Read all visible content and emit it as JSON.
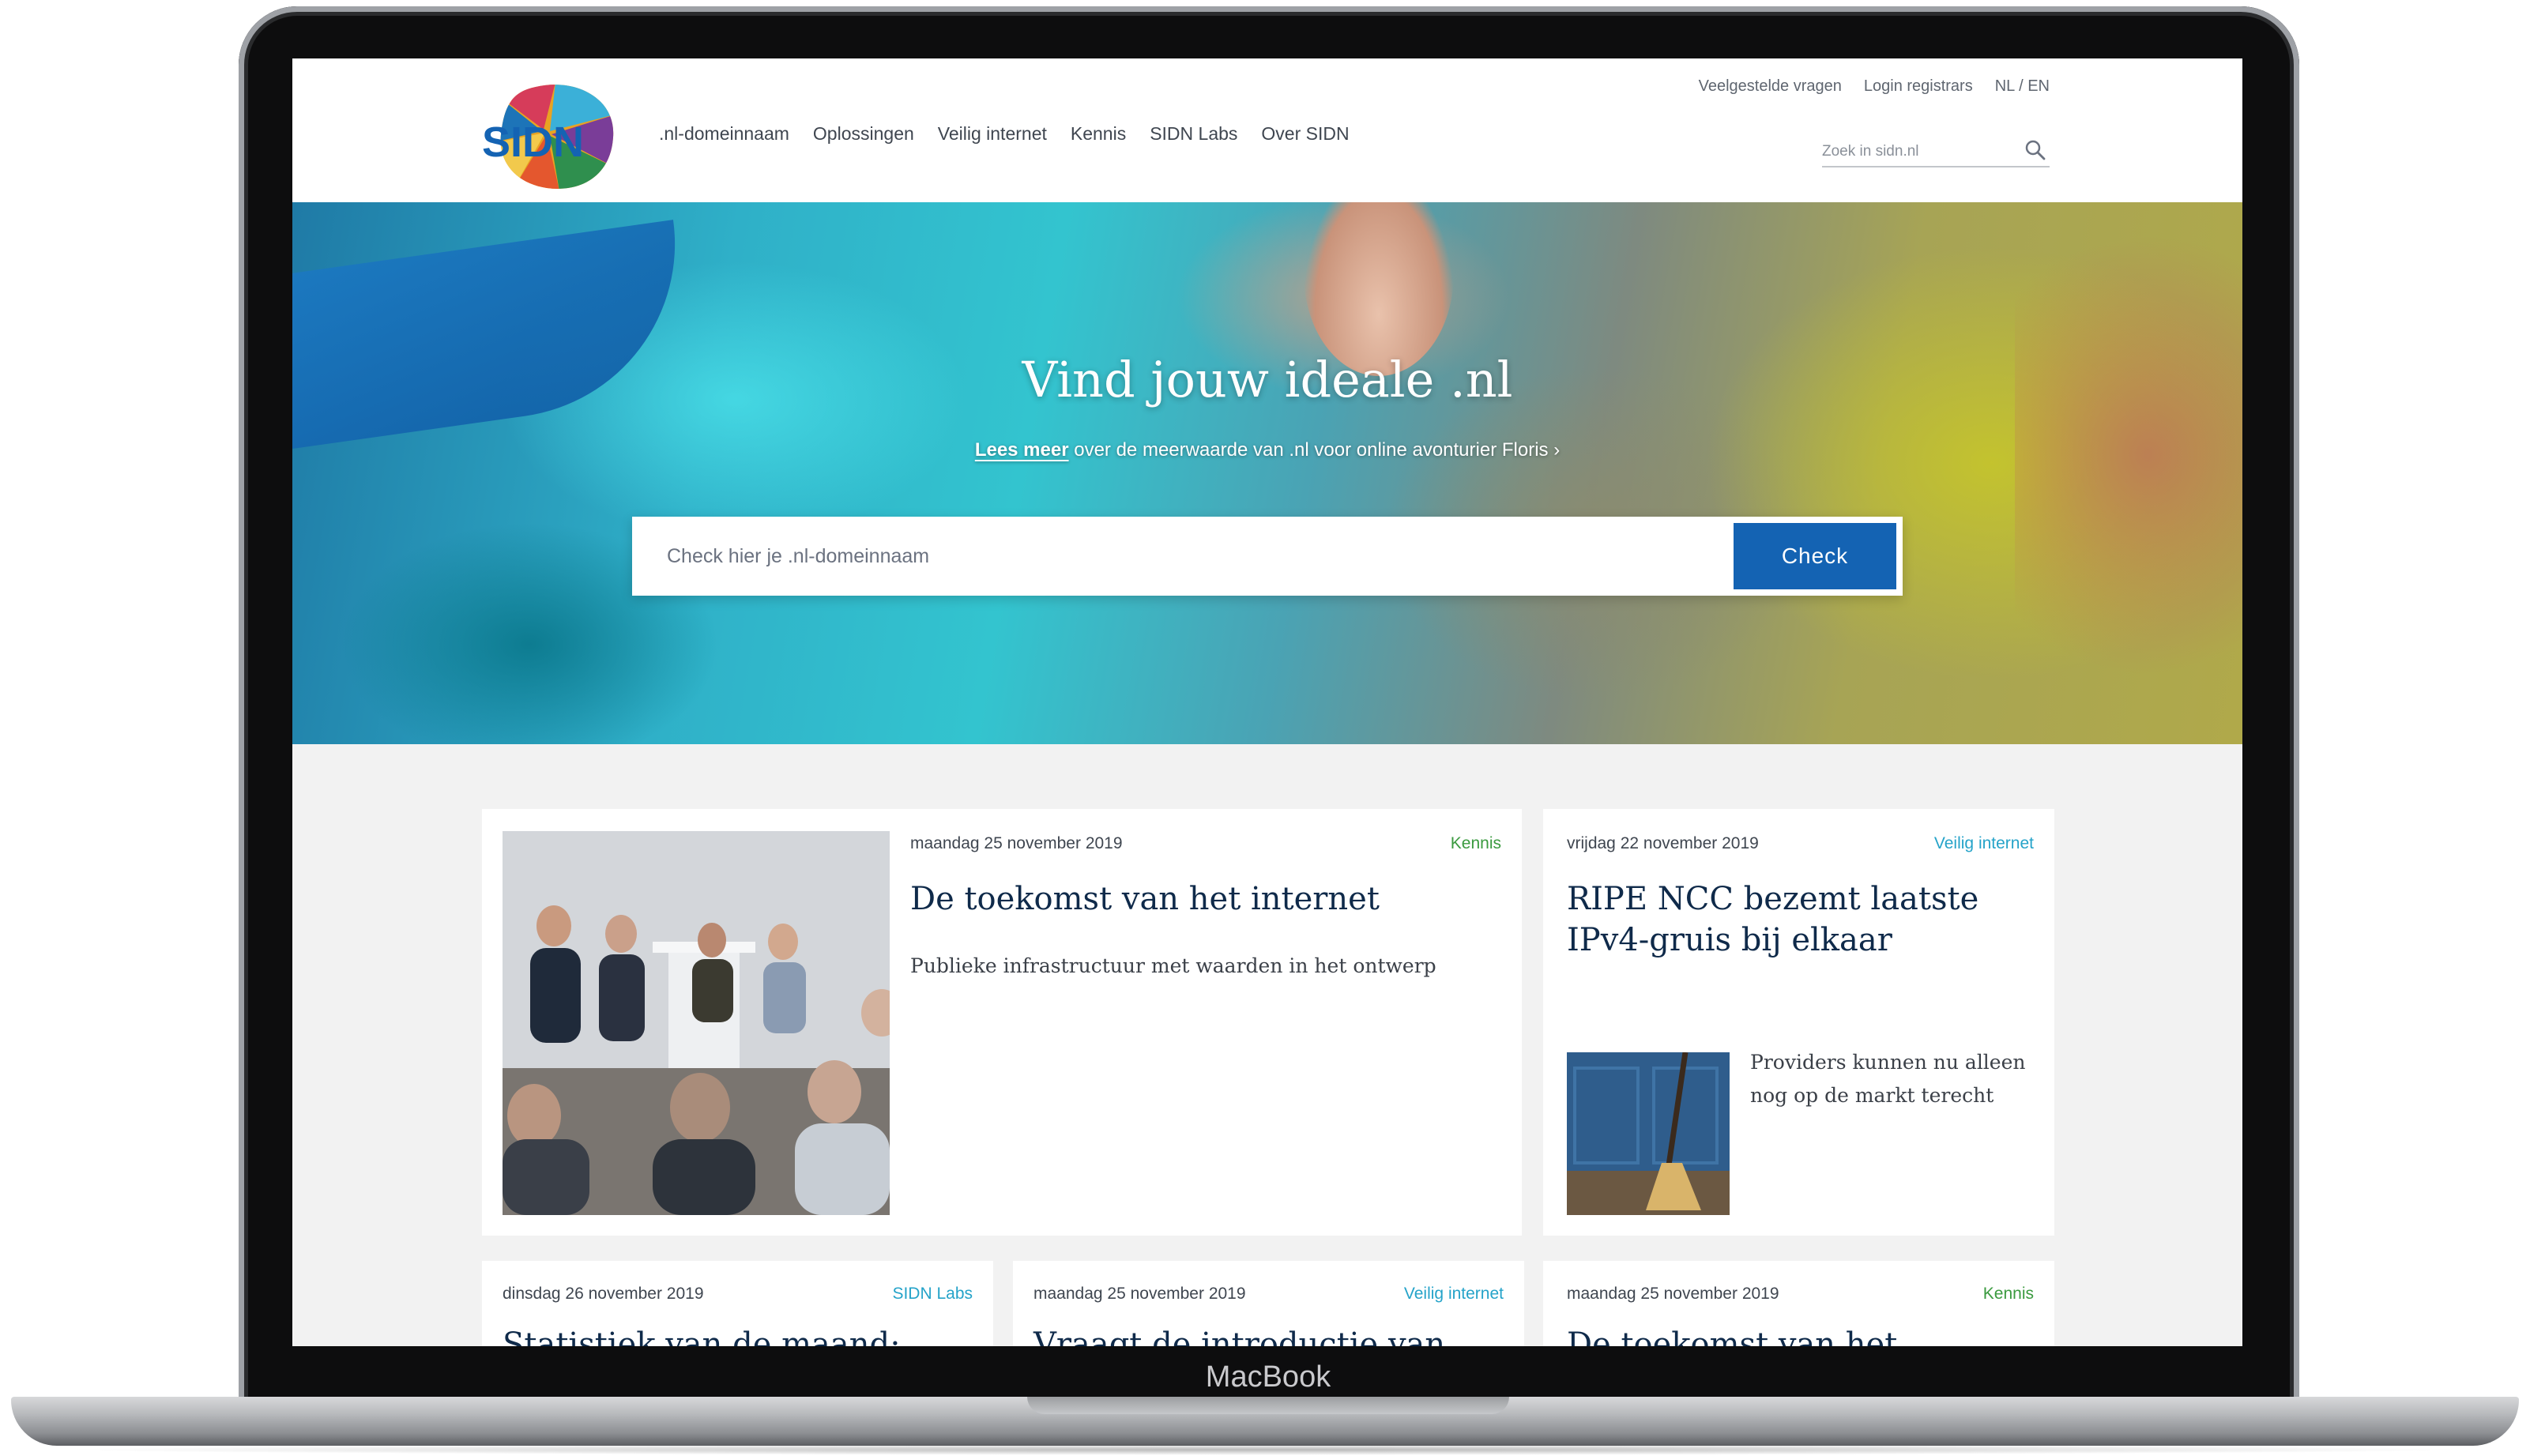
{
  "device": {
    "brand": "MacBook"
  },
  "header": {
    "logo_text": "SIDN",
    "nav": [
      ".nl-domeinnaam",
      "Oplossingen",
      "Veilig internet",
      "Kennis",
      "SIDN Labs",
      "Over SIDN"
    ],
    "utility": {
      "faq": "Veelgestelde vragen",
      "login": "Login registrars",
      "language": "NL / EN"
    },
    "search": {
      "placeholder": "Zoek in sidn.nl"
    }
  },
  "hero": {
    "title": "Vind jouw ideale .nl",
    "link_text": "Lees meer",
    "subtitle_rest": " over de meerwaarde van .nl voor online avonturier Floris ›",
    "domain_placeholder": "Check hier je .nl-domeinnaam",
    "check_label": "Check"
  },
  "colors": {
    "primary": "#1463b3",
    "kennis": "#3a9a3f",
    "veilig_internet": "#25a3c9",
    "sidn_labs": "#25a3c9",
    "navy": "#0f2a4a"
  },
  "cards": [
    {
      "date": "maandag 25 november 2019",
      "category": "Kennis",
      "category_color": "#3a9a3f",
      "title": "De toekomst van het internet",
      "summary": "Publieke infrastructuur met waarden in het ontwerp"
    },
    {
      "date": "vrijdag 22 november 2019",
      "category": "Veilig internet",
      "category_color": "#25a3c9",
      "title": "RIPE NCC bezemt laatste IPv4-gruis bij elkaar",
      "summary": "Providers kunnen nu alleen nog op de markt terecht"
    },
    {
      "date": "dinsdag 26 november 2019",
      "category": "SIDN Labs",
      "category_color": "#25a3c9",
      "title": "Statistiek van de maand:"
    },
    {
      "date": "maandag 25 november 2019",
      "category": "Veilig internet",
      "category_color": "#25a3c9",
      "title": "Vraagt de introductie van"
    },
    {
      "date": "maandag 25 november 2019",
      "category": "Kennis",
      "category_color": "#3a9a3f",
      "title": "De toekomst van het"
    }
  ]
}
